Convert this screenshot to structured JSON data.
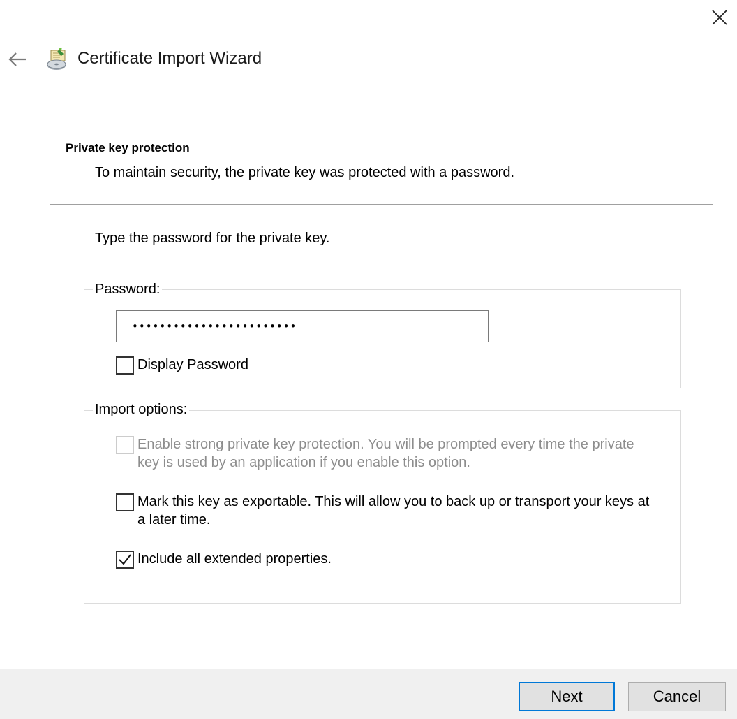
{
  "window": {
    "close_icon": "close-icon",
    "back_icon": "back-arrow-icon"
  },
  "header": {
    "title": "Certificate Import Wizard",
    "icon": "certificate-wizard-icon"
  },
  "section": {
    "heading": "Private key protection",
    "description": "To maintain security, the private key was protected with a password."
  },
  "main": {
    "prompt": "Type the password for the private key.",
    "password_group": {
      "legend": "Password:",
      "password_value": "123456789012345678901234",
      "display_password": {
        "label": "Display Password",
        "checked": false
      }
    },
    "import_options": {
      "legend": "Import options:",
      "options": [
        {
          "label": "Enable strong private key protection. You will be prompted every time the private key is used by an application if you enable this option.",
          "checked": false,
          "enabled": false
        },
        {
          "label": "Mark this key as exportable. This will allow you to back up or transport your keys at a later time.",
          "checked": false,
          "enabled": true
        },
        {
          "label": "Include all extended properties.",
          "checked": true,
          "enabled": true
        }
      ]
    }
  },
  "footer": {
    "next_label": "Next",
    "cancel_label": "Cancel"
  },
  "colors": {
    "accent": "#0078d7",
    "footer_bg": "#f0f0f0",
    "disabled_text": "#8d8d8d"
  }
}
